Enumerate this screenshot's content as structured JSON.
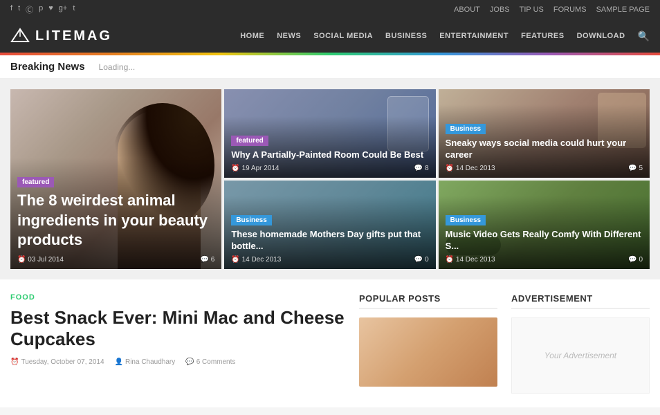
{
  "topbar": {
    "social_links": [
      {
        "name": "facebook",
        "symbol": "f"
      },
      {
        "name": "twitter",
        "symbol": "t"
      },
      {
        "name": "instagram",
        "symbol": "i"
      },
      {
        "name": "pinterest",
        "symbol": "p"
      },
      {
        "name": "heart",
        "symbol": "♥"
      },
      {
        "name": "google-plus",
        "symbol": "g+"
      },
      {
        "name": "tumblr",
        "symbol": "t"
      }
    ],
    "nav_links": [
      {
        "label": "About",
        "href": "#"
      },
      {
        "label": "Jobs",
        "href": "#"
      },
      {
        "label": "Tip Us",
        "href": "#"
      },
      {
        "label": "Forums",
        "href": "#"
      },
      {
        "label": "Sample Page",
        "href": "#"
      }
    ]
  },
  "header": {
    "logo_text": "LITEMAG",
    "nav_items": [
      {
        "label": "Home"
      },
      {
        "label": "News"
      },
      {
        "label": "Social Media"
      },
      {
        "label": "Business"
      },
      {
        "label": "Entertainment"
      },
      {
        "label": "Features"
      },
      {
        "label": "Download"
      }
    ]
  },
  "breaking_news": {
    "label": "Breaking News",
    "ticker": "Loading..."
  },
  "featured": {
    "main_card": {
      "badge": "featured",
      "title": "The 8 weirdest animal ingredients in your beauty products",
      "date": "03 Jul 2014",
      "comments": "6"
    },
    "top_right_1": {
      "badge": "featured",
      "title": "Why A Partially-Painted Room Could Be Best",
      "date": "19 Apr 2014",
      "comments": "8"
    },
    "top_right_2": {
      "badge": "Business",
      "title": "Sneaky ways social media could hurt your career",
      "date": "14 Dec 2013",
      "comments": "5"
    },
    "bottom_right_1": {
      "badge": "Business",
      "title": "These homemade Mothers Day gifts put that bottle...",
      "date": "14 Dec 2013",
      "comments": "0"
    },
    "bottom_right_2": {
      "badge": "Business",
      "title": "Music Video Gets Really Comfy With Different S...",
      "date": "14 Dec 2013",
      "comments": "0"
    }
  },
  "article": {
    "category": "Food",
    "title": "Best Snack Ever: Mini Mac and Cheese Cupcakes",
    "date": "Tuesday, October 07, 2014",
    "author": "Rina Chaudhary",
    "comments": "6 Comments"
  },
  "popular_posts": {
    "title": "Popular Posts"
  },
  "advertisement": {
    "title": "Advertisement",
    "placeholder": "Your Advertisement"
  }
}
